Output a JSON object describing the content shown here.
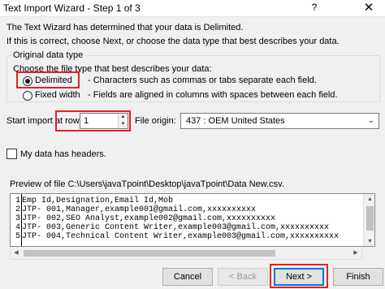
{
  "window": {
    "title": "Text Import Wizard - Step 1 of 3",
    "help_label": "?",
    "close_label": "✕"
  },
  "intro": {
    "line1": "The Text Wizard has determined that your data is Delimited.",
    "line2": "If this is correct, choose Next, or choose the data type that best describes your data."
  },
  "original_data_type": {
    "group_label": "Original data type",
    "prompt": "Choose the file type that best describes your data:",
    "options": [
      {
        "label": "Delimited",
        "description": "- Characters such as commas or tabs separate each field.",
        "selected": true
      },
      {
        "label": "Fixed width",
        "description": "- Fields are aligned in columns with spaces between each field.",
        "selected": false
      }
    ]
  },
  "start_import": {
    "label": "Start import at row:",
    "value": "1"
  },
  "file_origin": {
    "label": "File origin:",
    "value": "437 : OEM United States"
  },
  "headers_checkbox": {
    "label": "My data has headers.",
    "checked": false
  },
  "preview": {
    "caption": "Preview of file C:\\Users\\javaTpoint\\Desktop\\javaTpoint\\Data New.csv.",
    "rows": [
      {
        "num": "1",
        "text": "Emp Id,Designation,Email Id,Mob"
      },
      {
        "num": "2",
        "text": "JTP- 001,Manager,example001@gmail.com,xxxxxxxxxx"
      },
      {
        "num": "3",
        "text": "JTP- 002,SEO Analyst,example002@gmail.com,xxxxxxxxxx"
      },
      {
        "num": "4",
        "text": "JTP- 003,Generic Content Writer,example003@gmail.com,xxxxxxxxxx"
      },
      {
        "num": "5",
        "text": "JTP- 004,Technical Content Writer,example003@gmail.com,xxxxxxxxxx"
      }
    ]
  },
  "buttons": {
    "cancel": "Cancel",
    "back": "< Back",
    "next": "Next >",
    "finish": "Finish"
  },
  "icons": {
    "spin_up": "up-arrow",
    "spin_down": "down-arrow",
    "combo": "chevron-down-icon"
  },
  "colors": {
    "highlight": "#e0202a",
    "default_button_border": "#0078d7"
  }
}
